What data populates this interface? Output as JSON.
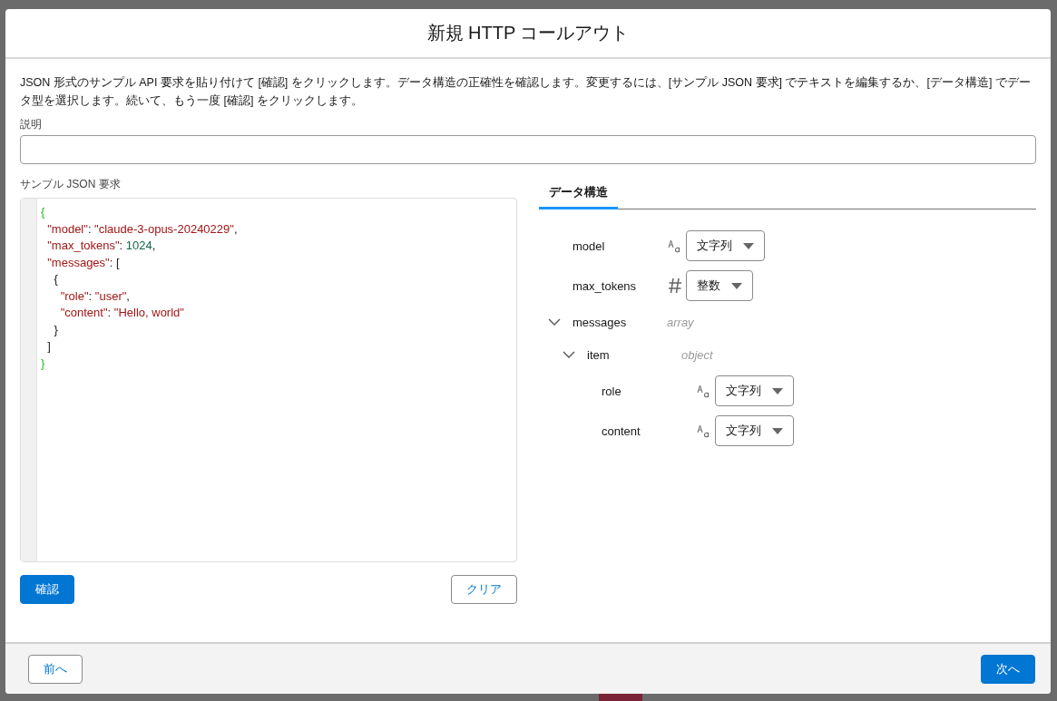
{
  "dialog": {
    "title": "新規 HTTP コールアウト",
    "instructions": "JSON 形式のサンプル API 要求を貼り付けて [確認] をクリックします。データ構造の正確性を確認します。変更するには、[サンプル JSON 要求] でテキストを編集するか、[データ構造] でデータ型を選択します。続いて、もう一度 [確認] をクリックします。",
    "description_field": {
      "label": "説明"
    },
    "sample": {
      "label": "サンプル JSON 要求",
      "lines": [
        [
          {
            "kind": "brace",
            "text": "{"
          }
        ],
        [
          {
            "kind": "key",
            "text": "  \"model\""
          },
          {
            "kind": "punct",
            "text": ": "
          },
          {
            "kind": "string",
            "text": "\"claude-3-opus-20240229\""
          },
          {
            "kind": "punct",
            "text": ","
          }
        ],
        [
          {
            "kind": "key",
            "text": "  \"max_tokens\""
          },
          {
            "kind": "punct",
            "text": ": "
          },
          {
            "kind": "number",
            "text": "1024"
          },
          {
            "kind": "punct",
            "text": ","
          }
        ],
        [
          {
            "kind": "key",
            "text": "  \"messages\""
          },
          {
            "kind": "punct",
            "text": ": ["
          }
        ],
        [
          {
            "kind": "punct",
            "text": "    {"
          }
        ],
        [
          {
            "kind": "key",
            "text": "      \"role\""
          },
          {
            "kind": "punct",
            "text": ": "
          },
          {
            "kind": "string",
            "text": "\"user\""
          },
          {
            "kind": "punct",
            "text": ","
          }
        ],
        [
          {
            "kind": "key",
            "text": "      \"content\""
          },
          {
            "kind": "punct",
            "text": ": "
          },
          {
            "kind": "string",
            "text": "\"Hello, world\""
          }
        ],
        [
          {
            "kind": "punct",
            "text": "    }"
          }
        ],
        [
          {
            "kind": "punct",
            "text": "  ]"
          }
        ],
        [
          {
            "kind": "brace",
            "text": "}"
          }
        ]
      ],
      "buttons": [
        {
          "label": "確認",
          "kind": "primary"
        },
        {
          "label": "クリア",
          "kind": "secondary"
        }
      ]
    },
    "structure": {
      "tabs": [
        {
          "label": "データ構造",
          "selected": true
        }
      ],
      "fields": [
        {
          "name": "model",
          "kind": "text",
          "value": "文字列"
        },
        {
          "name": "max_tokens",
          "kind": "number",
          "value": "整数"
        },
        {
          "name": "messages",
          "kind": "group",
          "type_label": "array",
          "expanded": true,
          "children": [
            {
              "name": "item",
              "kind": "group",
              "type_label": "object",
              "expanded": true,
              "children": [
                {
                  "name": "role",
                  "kind": "text",
                  "value": "文字列"
                },
                {
                  "name": "content",
                  "kind": "text",
                  "value": "文字列"
                }
              ]
            }
          ]
        }
      ]
    },
    "footer": {
      "buttons": [
        {
          "label": "前へ",
          "kind": "secondary"
        },
        {
          "label": "次へ",
          "kind": "primary"
        }
      ]
    }
  }
}
